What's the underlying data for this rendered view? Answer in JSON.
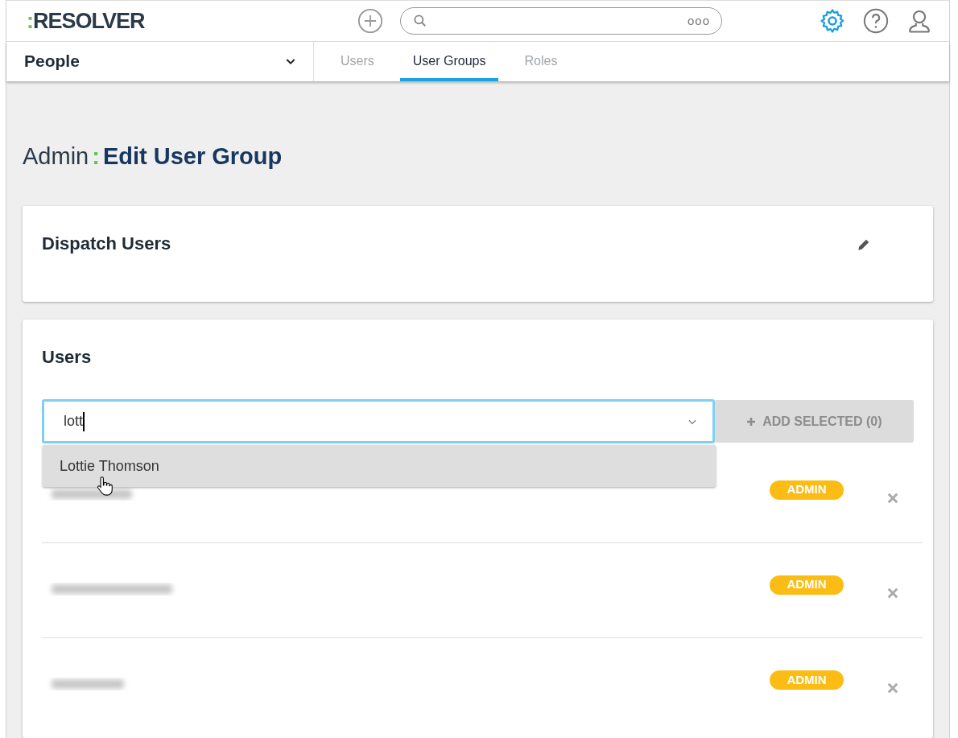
{
  "header": {
    "logo_mark": ":",
    "logo_text": "RESOLVER",
    "search": {
      "more": "ooo"
    }
  },
  "nav": {
    "section": "People",
    "tabs": [
      {
        "label": "Users",
        "selected": false
      },
      {
        "label": "User Groups",
        "selected": true
      },
      {
        "label": "Roles",
        "selected": false
      }
    ]
  },
  "page": {
    "crumb": "Admin",
    "separator": ":",
    "title": "Edit User Group"
  },
  "group": {
    "name": "Dispatch Users"
  },
  "users": {
    "heading": "Users",
    "search_value": "lott",
    "add_button": {
      "label": "ADD SELECTED (0)",
      "disabled": true
    },
    "suggestions": [
      {
        "label": "Lottie Thomson",
        "hovered": true
      }
    ],
    "rows": [
      {
        "badge": "ADMIN"
      },
      {
        "badge": "ADMIN"
      },
      {
        "badge": "ADMIN"
      }
    ]
  }
}
